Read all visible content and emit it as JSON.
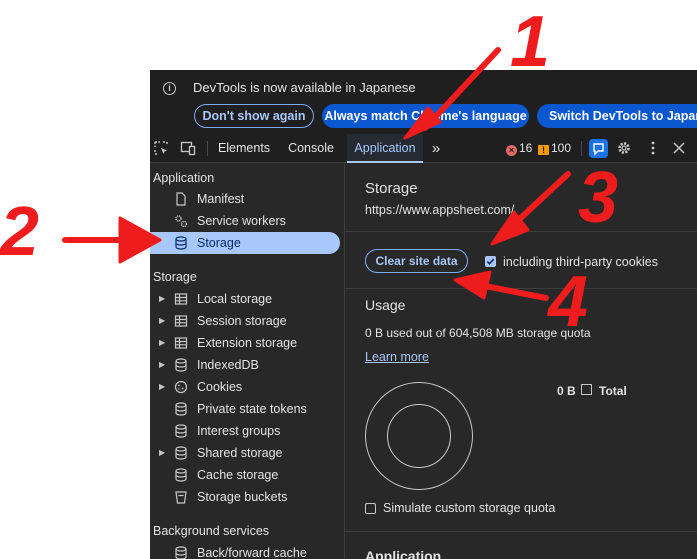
{
  "infobar": {
    "message": "DevTools is now available in Japanese",
    "buttons": [
      "Don't show again",
      "Always match Chrome's language",
      "Switch DevTools to Japanese"
    ]
  },
  "toolbar": {
    "tabs": [
      "Elements",
      "Console",
      "Application"
    ],
    "active_tab": "Application",
    "error_count": "16",
    "warning_count": "100"
  },
  "sidebar": {
    "application_header": "Application",
    "application_items": [
      "Manifest",
      "Service workers",
      "Storage"
    ],
    "selected_item": "Storage",
    "storage_header": "Storage",
    "storage_items": [
      "Local storage",
      "Session storage",
      "Extension storage",
      "IndexedDB",
      "Cookies",
      "Private state tokens",
      "Interest groups",
      "Shared storage",
      "Cache storage",
      "Storage buckets"
    ],
    "background_header": "Background services",
    "background_items": [
      "Back/forward cache"
    ]
  },
  "main": {
    "title": "Storage",
    "origin": "https://www.appsheet.com/",
    "clear_button": "Clear site data",
    "third_party_label": "including third-party cookies",
    "third_party_checked": true,
    "usage_header": "Usage",
    "usage_text": "0 B used out of 604,508 MB storage quota",
    "learn_more": "Learn more",
    "legend_value": "0 B",
    "legend_label": "Total",
    "simulate_label": "Simulate custom storage quota",
    "simulate_checked": false,
    "next_section": "Application"
  },
  "annotations": {
    "labels": [
      "1",
      "2",
      "3",
      "4"
    ],
    "color": "#ee1c1c"
  }
}
